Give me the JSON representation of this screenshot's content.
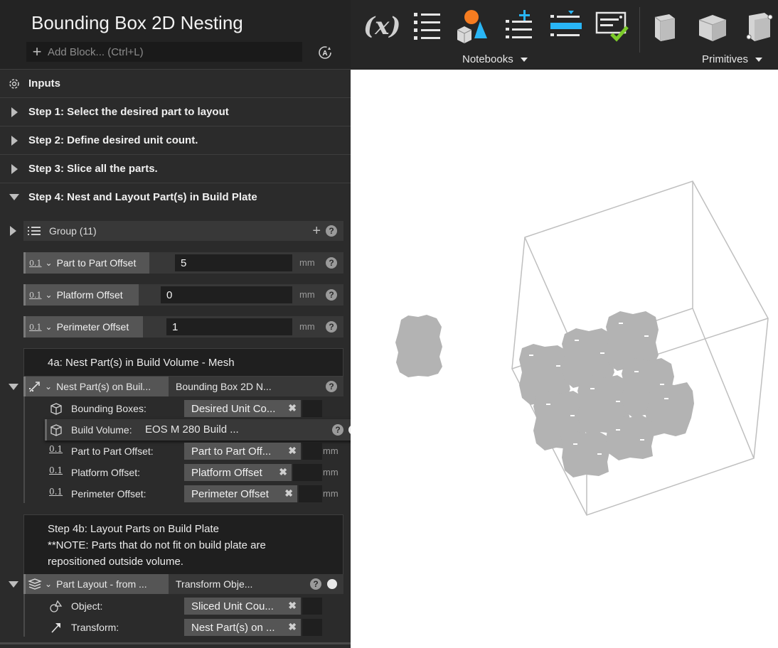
{
  "header": {
    "title": "Bounding Box 2D Nesting",
    "add_block_placeholder": "Add Block... (Ctrl+L)"
  },
  "sections": {
    "inputs": "Inputs",
    "step1": "Step 1: Select the desired part to layout",
    "step2": "Step 2: Define desired unit count.",
    "step3": "Step 3: Slice all the parts.",
    "step4": "Step 4: Nest and Layout Part(s) in Build Plate"
  },
  "group": {
    "label": "Group (11)",
    "add": "+",
    "help": "?"
  },
  "params": [
    {
      "prefix": "0.1",
      "label": "Part to Part Offset",
      "value": "5",
      "unit": "mm",
      "help": "?"
    },
    {
      "prefix": "0.1",
      "label": "Platform Offset",
      "value": "0",
      "unit": "mm",
      "help": "?"
    },
    {
      "prefix": "0.1",
      "label": "Perimeter Offset",
      "value": "1",
      "unit": "mm",
      "help": "?"
    }
  ],
  "block_4a": {
    "title": "4a: Nest Part(s) in Build Volume - Mesh",
    "op_label": "Nest Part(s) on Buil...",
    "op_ref": "Bounding Box 2D N...",
    "help": "?",
    "inputs": {
      "bounding_boxes": {
        "name": "Bounding Boxes:",
        "chip": "Desired Unit Co..."
      },
      "build_volume": {
        "name": "Build Volume:",
        "value": "EOS M 280 Build ...",
        "help": "?"
      },
      "part_to_part": {
        "prefix": "0.1",
        "name": "Part to Part Offset:",
        "chip": "Part to Part Off...",
        "unit": "mm"
      },
      "platform": {
        "prefix": "0.1",
        "name": "Platform Offset:",
        "chip": "Platform Offset",
        "unit": "mm"
      },
      "perimeter": {
        "prefix": "0.1",
        "name": "Perimeter Offset:",
        "chip": "Perimeter Offset",
        "unit": "mm"
      }
    }
  },
  "block_4b": {
    "title_line1": "Step 4b: Layout Parts on Build Plate",
    "title_line2": "**NOTE: Parts that do not fit on build plate are",
    "title_line3": "repositioned outside volume.",
    "op_label": "Part Layout - from ...",
    "op_ref": "Transform Obje...",
    "help": "?",
    "inputs": {
      "object": {
        "name": "Object:",
        "chip": "Sliced Unit Cou..."
      },
      "transform": {
        "name": "Transform:",
        "chip": "Nest Part(s) on ..."
      }
    }
  },
  "toolbar": {
    "icons": [
      "variable-icon",
      "list-icon",
      "shapes-icon",
      "add-list-icon",
      "insert-list-icon",
      "checklist-icon",
      "box-icon",
      "box-icon",
      "box-corner-icon"
    ],
    "variable_glyph": "(x)",
    "group_notebooks": "Notebooks",
    "group_primitives": "Primitives"
  },
  "colors": {
    "panel_bg": "#2b2b2b",
    "header_bg": "#232323",
    "accent_blue": "#29b6f6",
    "accent_orange": "#f57c20",
    "accent_green": "#7ccb2a"
  }
}
